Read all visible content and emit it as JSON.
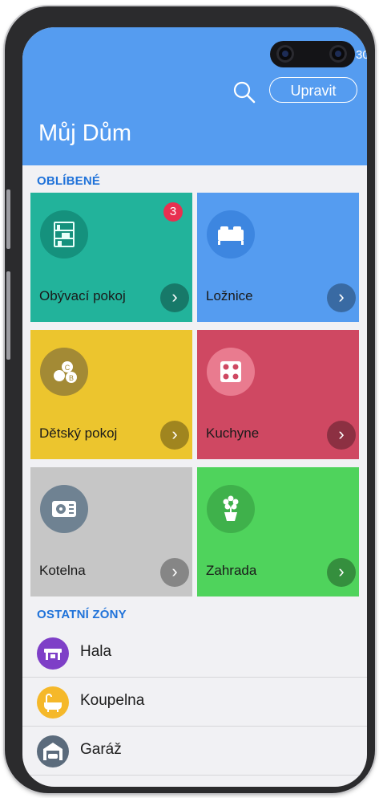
{
  "status_bar": {
    "time": "30"
  },
  "header": {
    "title": "Můj Dům",
    "edit_label": "Upravit",
    "color": "#559cf0"
  },
  "favorites": {
    "heading": "OBLÍBENÉ",
    "tiles": [
      {
        "name": "Obývací pokoj",
        "badge": "3",
        "color": "#22b39b",
        "icon": "shelf-icon"
      },
      {
        "name": "Ložnice",
        "color": "#559cf0",
        "icon": "bed-icon"
      },
      {
        "name": "Dětský pokoj",
        "color": "#ecc52e",
        "icon": "toy-blocks-icon"
      },
      {
        "name": "Kuchyne",
        "color": "#cf4862",
        "icon": "cooktop-icon"
      },
      {
        "name": "Kotelna",
        "color": "#c6c6c6",
        "icon": "boiler-icon"
      },
      {
        "name": "Zahrada",
        "color": "#4fd35c",
        "icon": "flower-pot-icon"
      }
    ]
  },
  "other_zones": {
    "heading": "OSTATNÍ ZÓNY",
    "items": [
      {
        "label": "Hala",
        "color": "#7e3fc7",
        "icon": "hall-icon"
      },
      {
        "label": "Koupelna",
        "color": "#f5b82a",
        "icon": "bathtub-icon"
      },
      {
        "label": "Garáž",
        "color": "#5b6b7c",
        "icon": "garage-icon"
      }
    ]
  }
}
